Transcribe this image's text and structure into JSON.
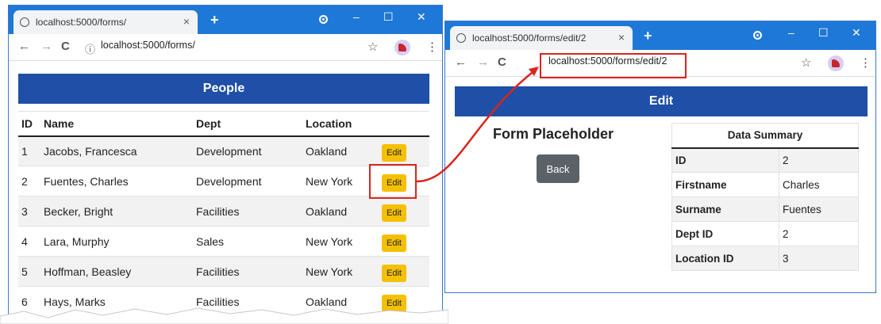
{
  "left_window": {
    "tab_title": "localhost:5000/forms/",
    "tab_close": "×",
    "new_tab": "+",
    "window_controls": [
      "–",
      "☐",
      "✕"
    ],
    "url": "localhost:5000/forms/",
    "nav_icons": [
      "←",
      "→",
      "C",
      "ⓘ"
    ],
    "star": "☆",
    "menu": "⋮",
    "heading": "People",
    "columns": [
      "ID",
      "Name",
      "Dept",
      "Location",
      ""
    ],
    "rows": [
      {
        "id": "1",
        "name": "Jacobs, Francesca",
        "dept": "Development",
        "location": "Oakland",
        "action": "Edit"
      },
      {
        "id": "2",
        "name": "Fuentes, Charles",
        "dept": "Development",
        "location": "New York",
        "action": "Edit"
      },
      {
        "id": "3",
        "name": "Becker, Bright",
        "dept": "Facilities",
        "location": "Oakland",
        "action": "Edit"
      },
      {
        "id": "4",
        "name": "Lara, Murphy",
        "dept": "Sales",
        "location": "New York",
        "action": "Edit"
      },
      {
        "id": "5",
        "name": "Hoffman, Beasley",
        "dept": "Facilities",
        "location": "New York",
        "action": "Edit"
      },
      {
        "id": "6",
        "name": "Hays, Marks",
        "dept": "Facilities",
        "location": "Oakland",
        "action": "Edit"
      }
    ]
  },
  "right_window": {
    "tab_title": "localhost:5000/forms/edit/2",
    "tab_close": "×",
    "new_tab": "+",
    "window_controls": [
      "–",
      "☐",
      "✕"
    ],
    "url": "localhost:5000/forms/edit/2",
    "nav_icons": [
      "←",
      "→",
      "C"
    ],
    "star": "☆",
    "menu": "⋮",
    "heading": "Edit",
    "form_placeholder": "Form Placeholder",
    "back_label": "Back",
    "summary_title": "Data Summary",
    "summary_rows": [
      {
        "key": "ID",
        "value": "2"
      },
      {
        "key": "Firstname",
        "value": "Charles"
      },
      {
        "key": "Surname",
        "value": "Fuentes"
      },
      {
        "key": "Dept ID",
        "value": "2"
      },
      {
        "key": "Location ID",
        "value": "3"
      }
    ]
  },
  "colors": {
    "titlebar": "#1e78d7",
    "banner": "#1f4fa6",
    "edit_button": "#f5c000",
    "back_button": "#5a6268",
    "highlight": "#d9251c"
  }
}
